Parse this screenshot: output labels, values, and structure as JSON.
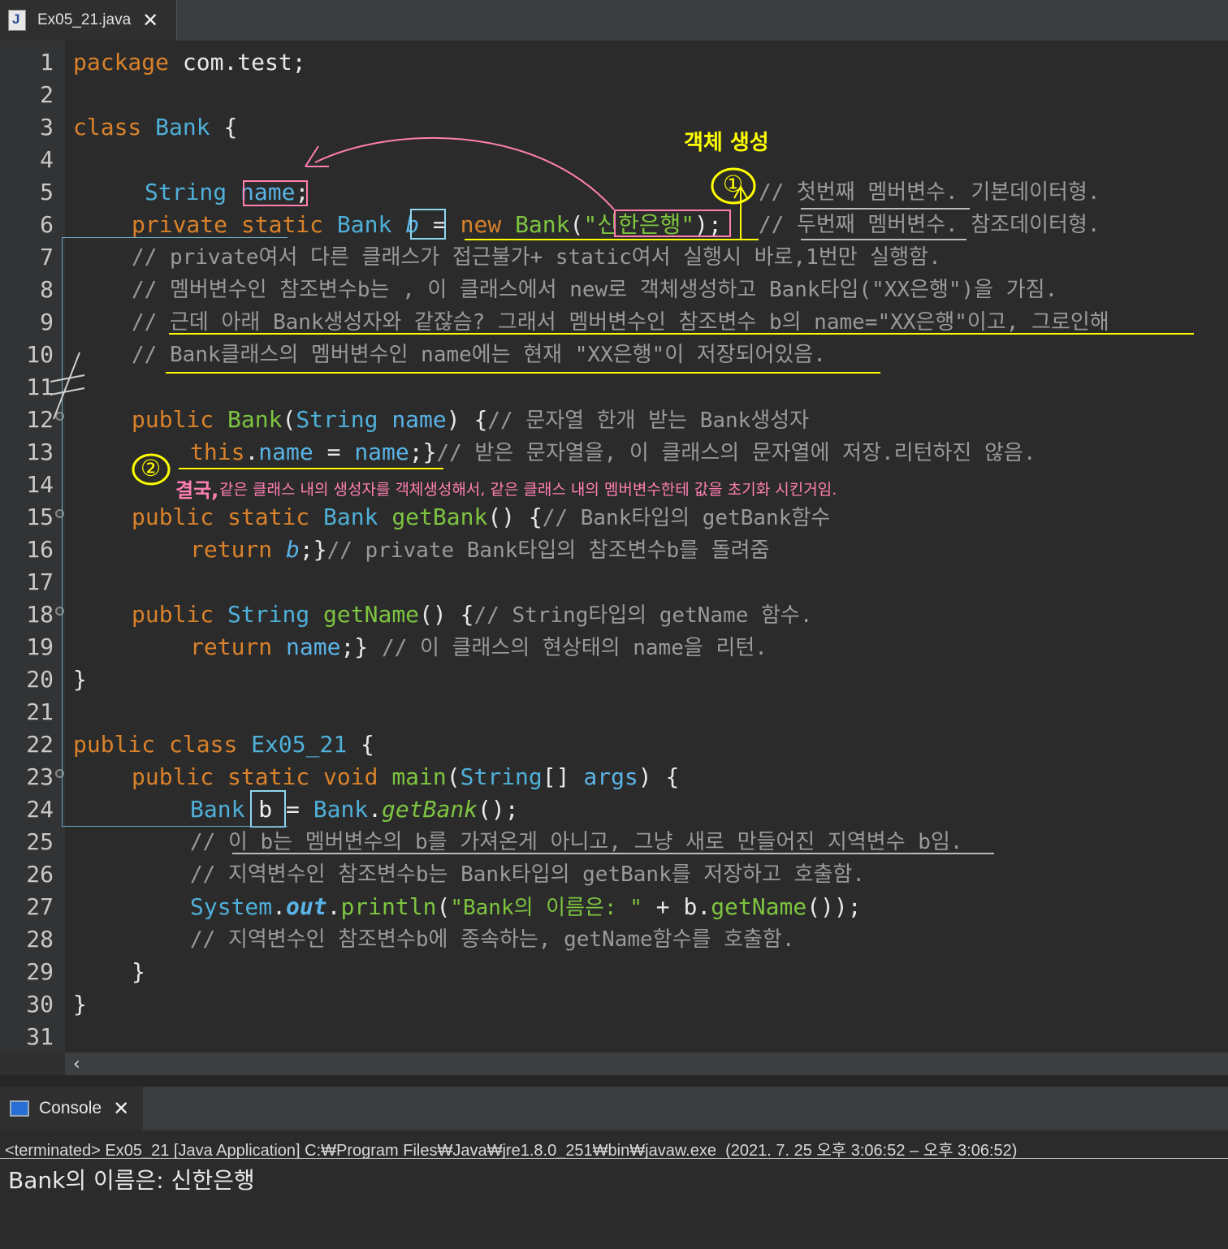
{
  "editor_tab": {
    "title": "Ex05_21.java",
    "icon": "java-file-icon",
    "close": "✕"
  },
  "code_lines": [
    {
      "n": "1"
    },
    {
      "n": "2"
    },
    {
      "n": "3"
    },
    {
      "n": "4"
    },
    {
      "n": "5"
    },
    {
      "n": "6"
    },
    {
      "n": "7"
    },
    {
      "n": "8"
    },
    {
      "n": "9"
    },
    {
      "n": "10"
    },
    {
      "n": "11"
    },
    {
      "n": "12"
    },
    {
      "n": "13"
    },
    {
      "n": "14"
    },
    {
      "n": "15"
    },
    {
      "n": "16"
    },
    {
      "n": "17"
    },
    {
      "n": "18"
    },
    {
      "n": "19"
    },
    {
      "n": "20"
    },
    {
      "n": "21"
    },
    {
      "n": "22"
    },
    {
      "n": "23"
    },
    {
      "n": "24"
    },
    {
      "n": "25"
    },
    {
      "n": "26"
    },
    {
      "n": "27"
    },
    {
      "n": "28"
    },
    {
      "n": "29"
    },
    {
      "n": "30"
    },
    {
      "n": "31"
    }
  ],
  "code": {
    "l1": {
      "kw": "package",
      "rest": " com.test;"
    },
    "l3": {
      "kw": "class",
      "name": " Bank ",
      "brace": "{"
    },
    "l5": {
      "type": "String",
      "var": "name",
      "rest": ";"
    },
    "l6": {
      "kw1": "private",
      "kw2": "static",
      "type": "Bank",
      "var": "b",
      "eq": " = ",
      "kw3": "new",
      "ctor": "Bank",
      "open": "(",
      "str": "\"신한은행\"",
      "close": ")",
      "semi": ";",
      "cm": "// 두번째 멤버변수. 참조데이터형."
    },
    "l5_cm": "// 첫번째 멤버변수. 기본데이터형.",
    "l7": "// private여서 다른 클래스가 접근불가+ static여서 실행시 바로,1번만 실행함.",
    "l8": "// 멤버변수인 참조변수b는 , 이 클래스에서 new로 객체생성하고 Bank타입(\"XX은행\")을 가짐.",
    "l9": "// 근데 아래 Bank생성자와 같잖슴? 그래서 멤버변수인 참조변수 b의 name=\"XX은행\"이고, 그로인해",
    "l10": "// Bank클래스의 멤버변수인 name에는 현재 \"XX은행\"이 저장되어있음.",
    "l12": {
      "kw": "public",
      "name": "Bank",
      "p1": "(",
      "type": "String",
      "var": "name",
      "p2": ") {",
      "cm": "// 문자열 한개 받는 Bank생성자"
    },
    "l13": {
      "kw": "this",
      "dot": ".",
      "f": "name",
      "eq": " = ",
      "v": "name",
      "end": ";}",
      "cm": "// 받은 문자열을, 이 클래스의 문자열에 저장.리턴하진 않음."
    },
    "l15": {
      "kw1": "public",
      "kw2": "static",
      "type": "Bank",
      "fn": "getBank",
      "rest": "() {",
      "cm": "// Bank타입의 getBank함수"
    },
    "l16": {
      "kw": "return",
      "v": "b",
      "rest": ";}",
      "cm": "// private Bank타입의 참조변수b를 돌려줌"
    },
    "l18": {
      "kw": "public",
      "type": "String",
      "fn": "getName",
      "rest": "() {",
      "cm": "// String타입의 getName 함수."
    },
    "l19": {
      "kw": "return",
      "v": "name",
      "rest": ";}",
      "cm": "// 이 클래스의 현상태의 name을 리턴."
    },
    "l20": "}",
    "l22": {
      "kw1": "public",
      "kw2": "class",
      "name": "Ex05_21",
      "rest": " {"
    },
    "l23": {
      "kw1": "public",
      "kw2": "static",
      "kw3": "void",
      "fn": "main",
      "p1": "(",
      "type": "String",
      "arr": "[] ",
      "var": "args",
      "rest": ") {"
    },
    "l24": {
      "type": "Bank",
      "var": "b",
      "eq": " = ",
      "cls": "Bank",
      "dot": ".",
      "fn": "getBank",
      "rest": "();"
    },
    "l25": "// 이 b는 멤버변수의 b를 가져온게 아니고, 그냥 새로 만들어진 지역변수 b임.",
    "l26": "// 지역변수인 참조변수b는 Bank타입의 getBank를 저장하고 호출함.",
    "l27": {
      "cls": "System",
      "dot1": ".",
      "field": "out",
      "dot2": ".",
      "fn": "println",
      "p1": "(",
      "str": "\"Bank의 이름은: \"",
      "plus": " + b.",
      "fn2": "getName",
      "rest": "());"
    },
    "l28": "// 지역변수인 참조변수b에 종속하는, getName함수를 호출함.",
    "l29": "}",
    "l30": "}"
  },
  "annotations": {
    "circle1": "①",
    "circle2": "②",
    "object_creation": "객체 생성",
    "result_label": "결국,",
    "result_note": "같은 클래스 내의 생성자를 객체생성해서, 같은 클래스 내의 멤버변수한테 값을 초기화 시킨거임."
  },
  "scroll_left": "‹",
  "console": {
    "tab_title": "Console",
    "icon": "console-monitor-icon",
    "close": "✕",
    "status": "<terminated> Ex05_21 [Java Application] C:₩Program Files₩Java₩jre1.8.0_251₩bin₩javaw.exe  (2021. 7. 25 오후 3:06:52 – 오후 3:06:52)",
    "output": "Bank의 이름은: 신한은행"
  },
  "colors": {
    "keyword": "#d9822b",
    "type": "#4fb0d9",
    "function": "#7dc540",
    "comment": "#9a9a9a",
    "pink": "#ff7fb0",
    "yellow": "#ffff00",
    "cyan": "#8ed8ee"
  }
}
